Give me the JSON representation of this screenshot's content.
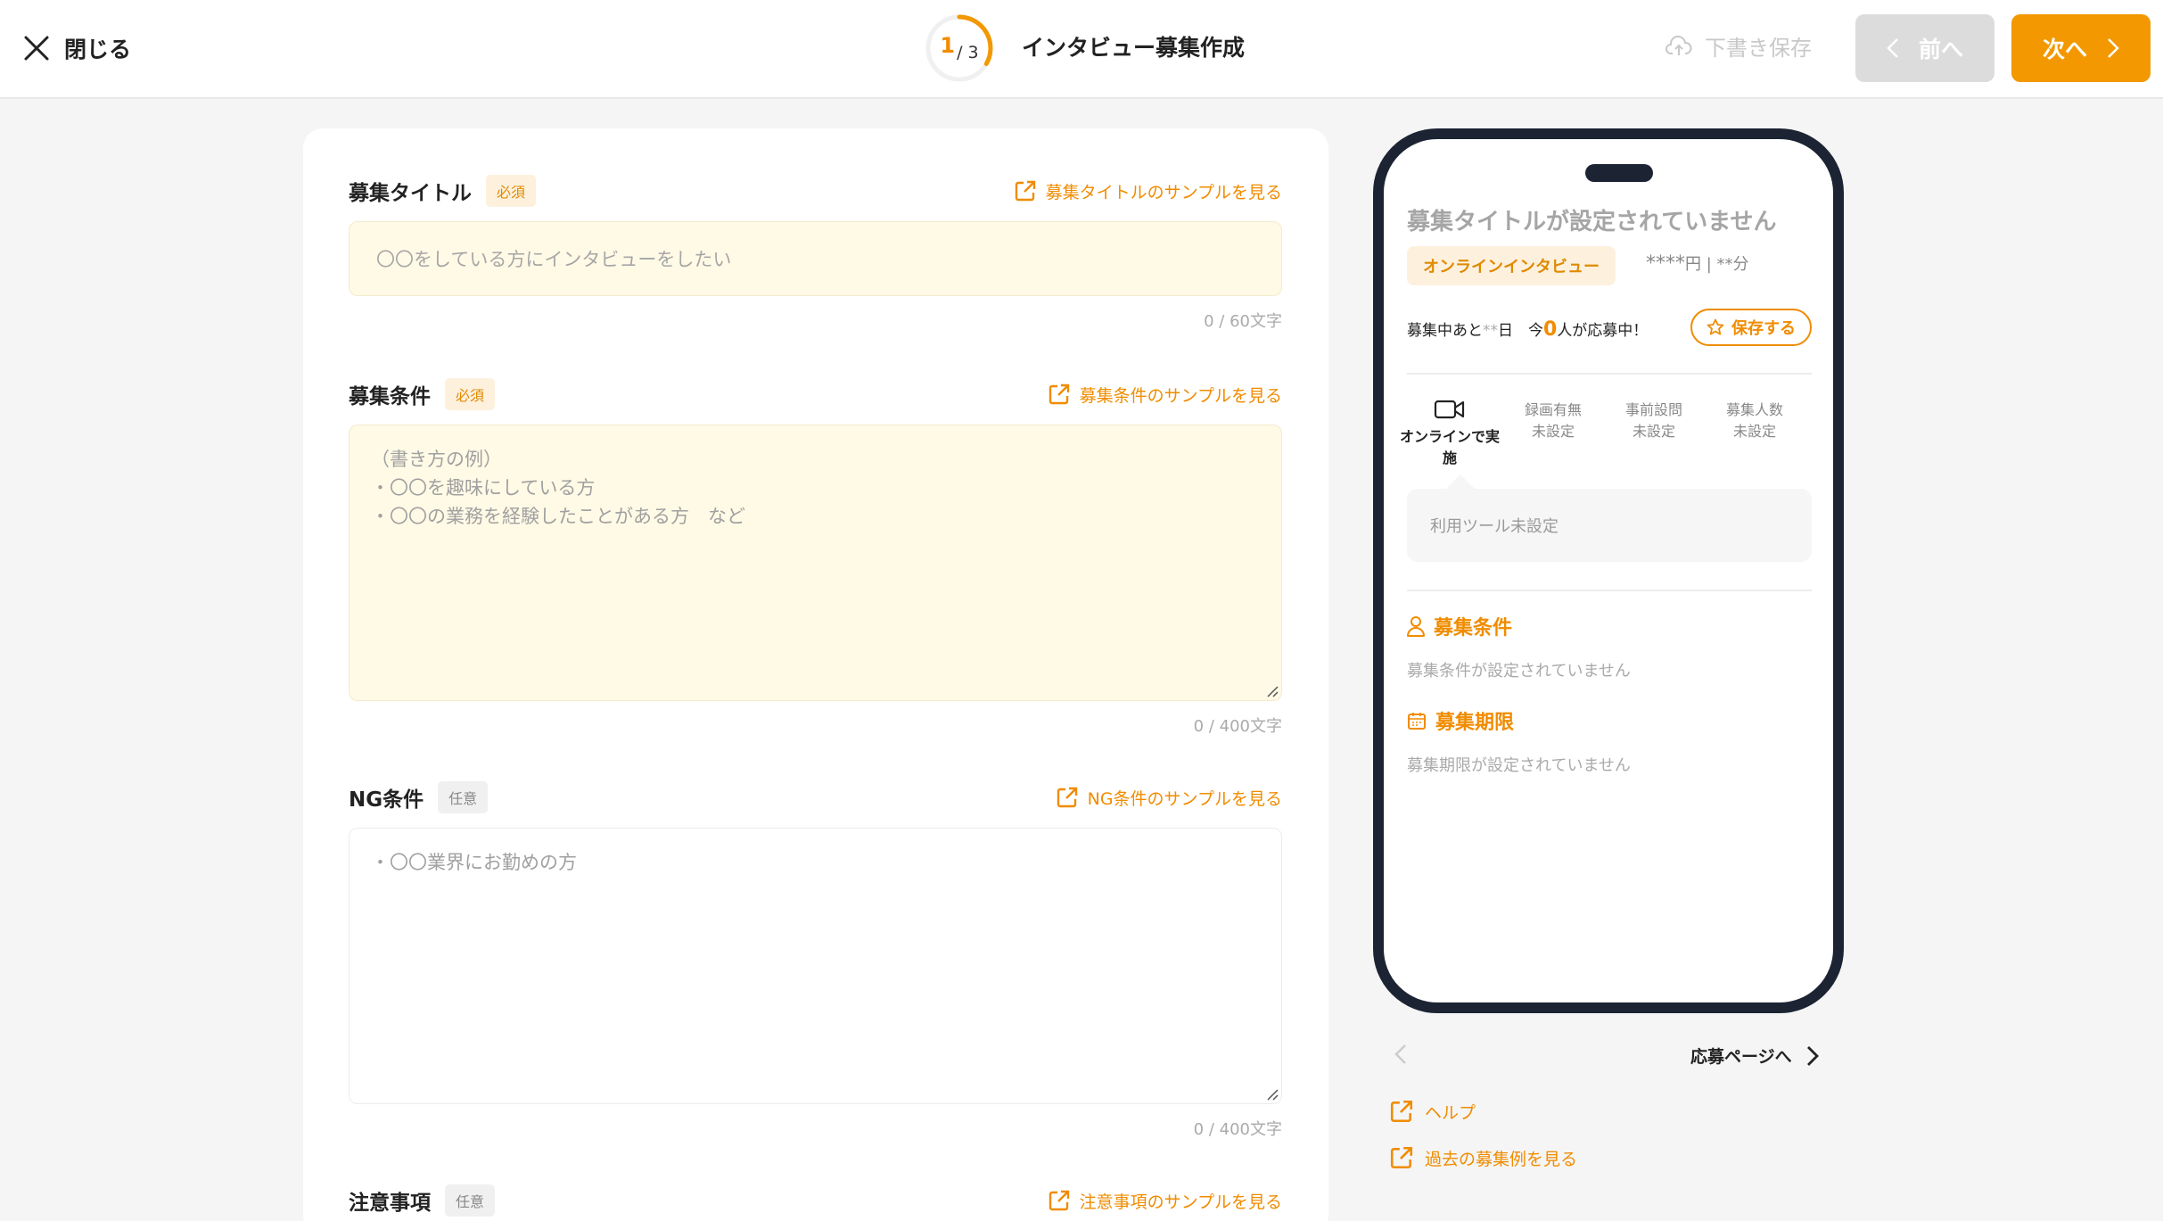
{
  "header": {
    "close_label": "閉じる",
    "step_current": "1",
    "step_total": "/ 3",
    "step_progress": 0.333,
    "title": "インタビュー募集作成",
    "draft_label": "下書き保存",
    "prev_label": "前へ",
    "next_label": "次へ"
  },
  "form": {
    "title_field": {
      "label": "募集タイトル",
      "badge": "必須",
      "sample_link": "募集タイトルのサンプルを見る",
      "placeholder": "〇〇をしている方にインタビューをしたい",
      "count": "0 / 60文字"
    },
    "conditions_field": {
      "label": "募集条件",
      "badge": "必須",
      "sample_link": "募集条件のサンプルを見る",
      "placeholder_lines": [
        "（書き方の例）",
        "・〇〇を趣味にしている方",
        "・〇〇の業務を経験したことがある方　など"
      ],
      "count": "0 / 400文字"
    },
    "ng_field": {
      "label": "NG条件",
      "badge": "任意",
      "sample_link": "NG条件のサンプルを見る",
      "placeholder": "・〇〇業界にお勤めの方",
      "count": "0 / 400文字"
    },
    "notes_field": {
      "label": "注意事項",
      "badge": "任意",
      "sample_link": "注意事項のサンプルを見る"
    }
  },
  "preview": {
    "title": "募集タイトルが設定されていません",
    "tag": "オンラインインタビュー",
    "fee_stars": "****",
    "fee_unit": "円 | **分",
    "status_prefix": "募集中あと",
    "status_days": "**",
    "status_day_unit": "日　今",
    "status_count": "0",
    "status_suffix": "人が応募中！",
    "save_label": "保存する",
    "info": {
      "online_label": "オンラインで実施",
      "recording_title": "録画有無",
      "recording_value": "未設定",
      "question_title": "事前設問",
      "question_value": "未設定",
      "people_title": "募集人数",
      "people_value": "未設定"
    },
    "tool_text": "利用ツール未設定",
    "conditions_heading": "募集条件",
    "conditions_text": "募集条件が設定されていません",
    "period_heading": "募集期限",
    "period_text": "募集期限が設定されていません"
  },
  "preview_nav": {
    "apply_label": "応募ページへ"
  },
  "links": {
    "help": "ヘルプ",
    "past_examples": "過去の募集例を見る"
  },
  "colors": {
    "accent": "#f39800",
    "input_fill": "#fffae6",
    "phone_frame": "#1c2434"
  }
}
